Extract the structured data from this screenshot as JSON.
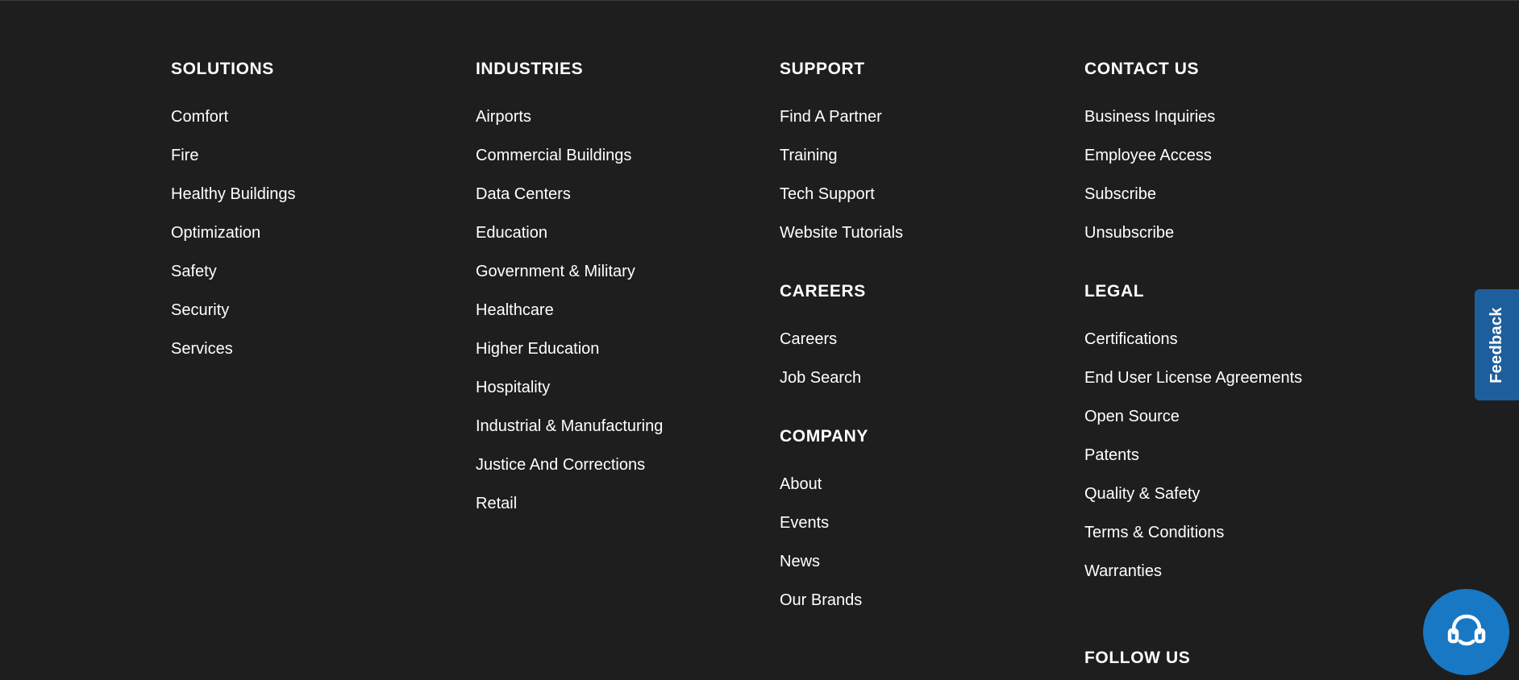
{
  "columns": [
    {
      "sections": [
        {
          "heading": "SOLUTIONS",
          "links": [
            "Comfort",
            "Fire",
            "Healthy Buildings",
            "Optimization",
            "Safety",
            "Security",
            "Services"
          ]
        }
      ]
    },
    {
      "sections": [
        {
          "heading": "INDUSTRIES",
          "links": [
            "Airports",
            "Commercial Buildings",
            "Data Centers",
            "Education",
            "Government & Military",
            "Healthcare",
            "Higher Education",
            "Hospitality",
            "Industrial & Manufacturing",
            "Justice And Corrections",
            "Retail"
          ]
        }
      ]
    },
    {
      "sections": [
        {
          "heading": "SUPPORT",
          "links": [
            "Find A Partner",
            "Training",
            "Tech Support",
            "Website Tutorials"
          ]
        },
        {
          "heading": "CAREERS",
          "links": [
            "Careers",
            "Job Search"
          ]
        },
        {
          "heading": "COMPANY",
          "links": [
            "About",
            "Events",
            "News",
            "Our Brands"
          ]
        }
      ]
    },
    {
      "sections": [
        {
          "heading": "CONTACT US",
          "links": [
            "Business Inquiries",
            "Employee Access",
            "Subscribe",
            "Unsubscribe"
          ]
        },
        {
          "heading": "LEGAL",
          "links": [
            "Certifications",
            "End User License Agreements",
            "Open Source",
            "Patents",
            "Quality & Safety",
            "Terms & Conditions",
            "Warranties"
          ]
        },
        {
          "heading": "FOLLOW US",
          "links": []
        }
      ]
    }
  ],
  "feedback": {
    "label": "Feedback"
  },
  "support_widget": {
    "icon": "headset-icon"
  },
  "colors": {
    "background": "#1e1e1e",
    "text": "#ffffff",
    "feedback_tab": "#1d5f9c",
    "support_bubble": "#1878c4"
  }
}
